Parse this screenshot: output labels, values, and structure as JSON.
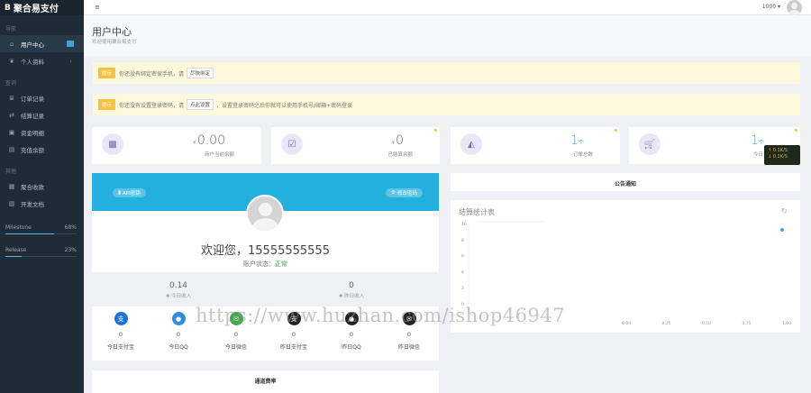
{
  "brand": {
    "icon": "B",
    "name": "聚合易支付"
  },
  "sidebar": {
    "sections": [
      {
        "title": "导航",
        "items": [
          {
            "icon": "home-icon",
            "glyph": "⌂",
            "label": "用户中心",
            "active": true,
            "badge": true
          },
          {
            "icon": "leaf-icon",
            "glyph": "❦",
            "label": "个人资料",
            "chevron": "‹"
          }
        ]
      },
      {
        "title": "查询",
        "items": [
          {
            "icon": "list-icon",
            "glyph": "≣",
            "label": "订单记录"
          },
          {
            "icon": "transfer-icon",
            "glyph": "⇄",
            "label": "结算记录"
          },
          {
            "icon": "lock-icon",
            "glyph": "▣",
            "label": "资金明细"
          },
          {
            "icon": "clipboard-icon",
            "glyph": "▤",
            "label": "充值余额"
          }
        ]
      },
      {
        "title": "其他",
        "items": [
          {
            "icon": "grid-icon",
            "glyph": "▦",
            "label": "聚合收款"
          },
          {
            "icon": "doc-icon",
            "glyph": "▧",
            "label": "开发文档"
          }
        ]
      }
    ],
    "progress": [
      {
        "label": "Milestone",
        "percent": "68%",
        "value": 0.68
      },
      {
        "label": "Release",
        "percent": "23%",
        "value": 0.23
      }
    ]
  },
  "topbar": {
    "menu_icon": "≡",
    "user": "1000 ▾"
  },
  "header": {
    "title": "用户中心",
    "subtitle": "欢迎使用聚合易支付"
  },
  "alerts": [
    {
      "tag": "提示",
      "text1": "你还没有绑定密保手机，请",
      "button": "尽快绑定",
      "text2": ""
    },
    {
      "tag": "提示",
      "text1": "你还没有设置登录密码，请",
      "button": "点此设置",
      "text2": "，设置登录密码之后你就可以使用手机号/邮箱+密码登录"
    }
  ],
  "stats": [
    {
      "icon": "money-icon",
      "glyph": "▩",
      "currency": "¥",
      "value": "0.00",
      "unit": "",
      "label": "商户当前余额",
      "teal": false
    },
    {
      "icon": "check-icon",
      "glyph": "☑",
      "currency": "¥",
      "value": "0",
      "unit": "",
      "label": "已结算余额",
      "teal": false
    },
    {
      "icon": "area-chart-icon",
      "glyph": "◭",
      "currency": "",
      "value": "1",
      "unit": "个",
      "label": "订单总数",
      "teal": true
    },
    {
      "icon": "cart-icon",
      "glyph": "🛒",
      "currency": "",
      "value": "1",
      "unit": "个",
      "label": "今日订单",
      "teal": true
    }
  ],
  "overlay": {
    "line1": "↑ 0.1K/S",
    "line2": "↓ 0.1K/S"
  },
  "profile": {
    "left_pill": "API密钥",
    "right_pill": "修改密码",
    "welcome": "欢迎您，15555555555",
    "status_label": "账户状态：",
    "status_value": "正常",
    "income": [
      {
        "value": "0.14",
        "caption": "✚ 今日收入"
      },
      {
        "value": "0",
        "caption": "✚ 昨日收入"
      }
    ],
    "payments": [
      {
        "icon": "alipay-icon",
        "glyph": "支",
        "color": "#1a73d8",
        "count": "0",
        "name": "今日支付宝"
      },
      {
        "icon": "qq-icon",
        "glyph": "●",
        "color": "#2f8ee0",
        "count": "0",
        "name": "今日QQ"
      },
      {
        "icon": "wechat-icon",
        "glyph": "✉",
        "color": "#3ea84a",
        "count": "0",
        "name": "今日微信"
      },
      {
        "icon": "alipay-dark-icon",
        "glyph": "支",
        "color": "#222",
        "count": "0",
        "name": "昨日支付宝"
      },
      {
        "icon": "qq-dark-icon",
        "glyph": "●",
        "color": "#222",
        "count": "0",
        "name": "昨日QQ"
      },
      {
        "icon": "wechat-dark-icon",
        "glyph": "✉",
        "color": "#222",
        "count": "0",
        "name": "昨日微信"
      }
    ],
    "channel_title": "通道费率"
  },
  "notice": {
    "title": "公告通知"
  },
  "chart": {
    "title": "结算统计表",
    "refresh_icon": "↻",
    "legend": "",
    "y_ticks": [
      "10",
      "8",
      "6",
      "4",
      "2",
      "0"
    ],
    "x_ticks": [
      "0.00",
      "0.25",
      "0.50",
      "0.75",
      "1.00"
    ]
  },
  "watermark": "https://www.huzhan.com/ishop46947"
}
